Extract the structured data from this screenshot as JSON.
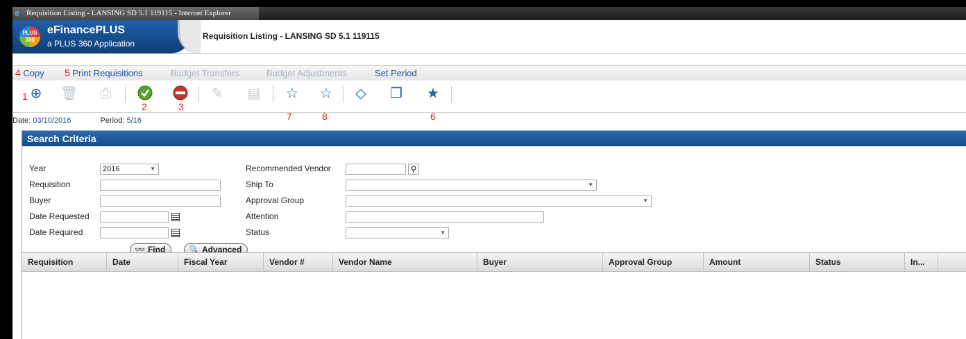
{
  "window": {
    "title": "Requisition Listing - LANSING SD 5.1 119115 - Internet Explorer"
  },
  "banner": {
    "logo_text": "PLUS 360",
    "app_name": "eFinancePLUS",
    "app_subtitle": "a PLUS 360 Application",
    "page_title": "Requisition Listing - LANSING SD 5.1 119115"
  },
  "menu": {
    "items": [
      {
        "callout": "4",
        "label": "Copy",
        "state": "active"
      },
      {
        "callout": "5",
        "label": "Print Requisitions",
        "state": "active"
      },
      {
        "callout": "",
        "label": "Budget Transfers",
        "state": "disabled"
      },
      {
        "callout": "",
        "label": "Budget Adjustments",
        "state": "disabled"
      },
      {
        "callout": "",
        "label": "Set Period",
        "state": "active"
      }
    ]
  },
  "toolbar": {
    "buttons": [
      {
        "icon": "add-icon",
        "enabled": true
      },
      {
        "icon": "delete-icon",
        "enabled": false
      },
      {
        "icon": "print-icon",
        "enabled": false
      },
      {
        "icon": "ok-icon",
        "enabled": true
      },
      {
        "icon": "back-icon",
        "enabled": true
      },
      {
        "icon": "edit-document-icon",
        "enabled": false
      },
      {
        "icon": "document-icon",
        "enabled": false
      },
      {
        "icon": "star-outline-icon",
        "enabled": true
      },
      {
        "icon": "star-outline-icon",
        "enabled": true
      },
      {
        "icon": "diamond-icon",
        "enabled": true
      },
      {
        "icon": "copy-icon",
        "enabled": true
      },
      {
        "icon": "star-filled-icon",
        "enabled": true
      }
    ],
    "callouts": [
      "1",
      "2",
      "3",
      "7",
      "8",
      "6"
    ]
  },
  "info": {
    "date_label": "Date:",
    "date_value": "03/10/2016",
    "period_label": "Period:",
    "period_value": "5/16"
  },
  "search": {
    "title": "Search Criteria",
    "year_label": "Year",
    "year_value": "2016",
    "requisition_label": "Requisition",
    "buyer_label": "Buyer",
    "date_requested_label": "Date Requested",
    "date_required_label": "Date Required",
    "recommended_vendor_label": "Recommended Vendor",
    "ship_to_label": "Ship To",
    "approval_group_label": "Approval Group",
    "attention_label": "Attention",
    "status_label": "Status",
    "find_label": "Find",
    "advanced_label": "Advanced"
  },
  "grid": {
    "columns": [
      "Requisition",
      "Date",
      "Fiscal Year",
      "Vendor #",
      "Vendor Name",
      "Buyer",
      "Approval Group",
      "Amount",
      "Status",
      "In..."
    ]
  },
  "colors": {
    "accent_blue": "#1f4f9a",
    "header_blue": "#164d8a",
    "callout_red": "#e0231b"
  }
}
